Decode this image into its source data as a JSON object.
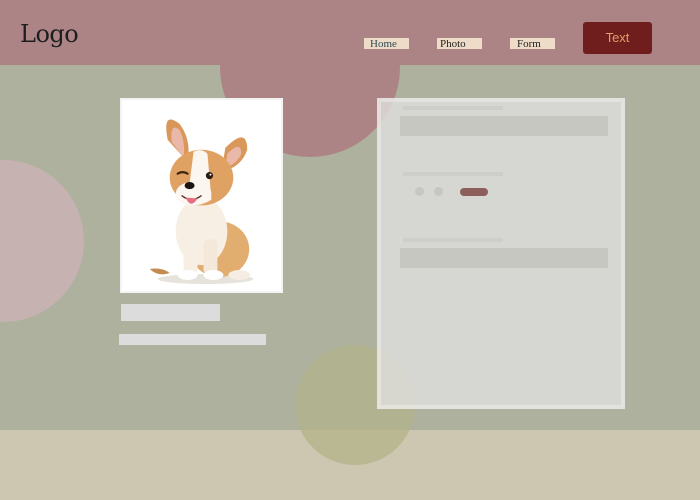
{
  "header": {
    "logo_text": "Logo",
    "nav": [
      {
        "label": "Home"
      },
      {
        "label": "Photo"
      },
      {
        "label": "Form"
      }
    ],
    "cta_label": "Text"
  },
  "photo": {
    "subject_icon": "corgi-puppy-photo"
  },
  "colors": {
    "header_bg": "#ad8485",
    "main_bg": "#adb19e",
    "footer_bg": "#cdc7b1",
    "cta_bg": "#6f1d1d",
    "cta_text": "#e1a06a",
    "nav_bg": "#efdcc8",
    "toggle_active": "#8d5f5c"
  }
}
